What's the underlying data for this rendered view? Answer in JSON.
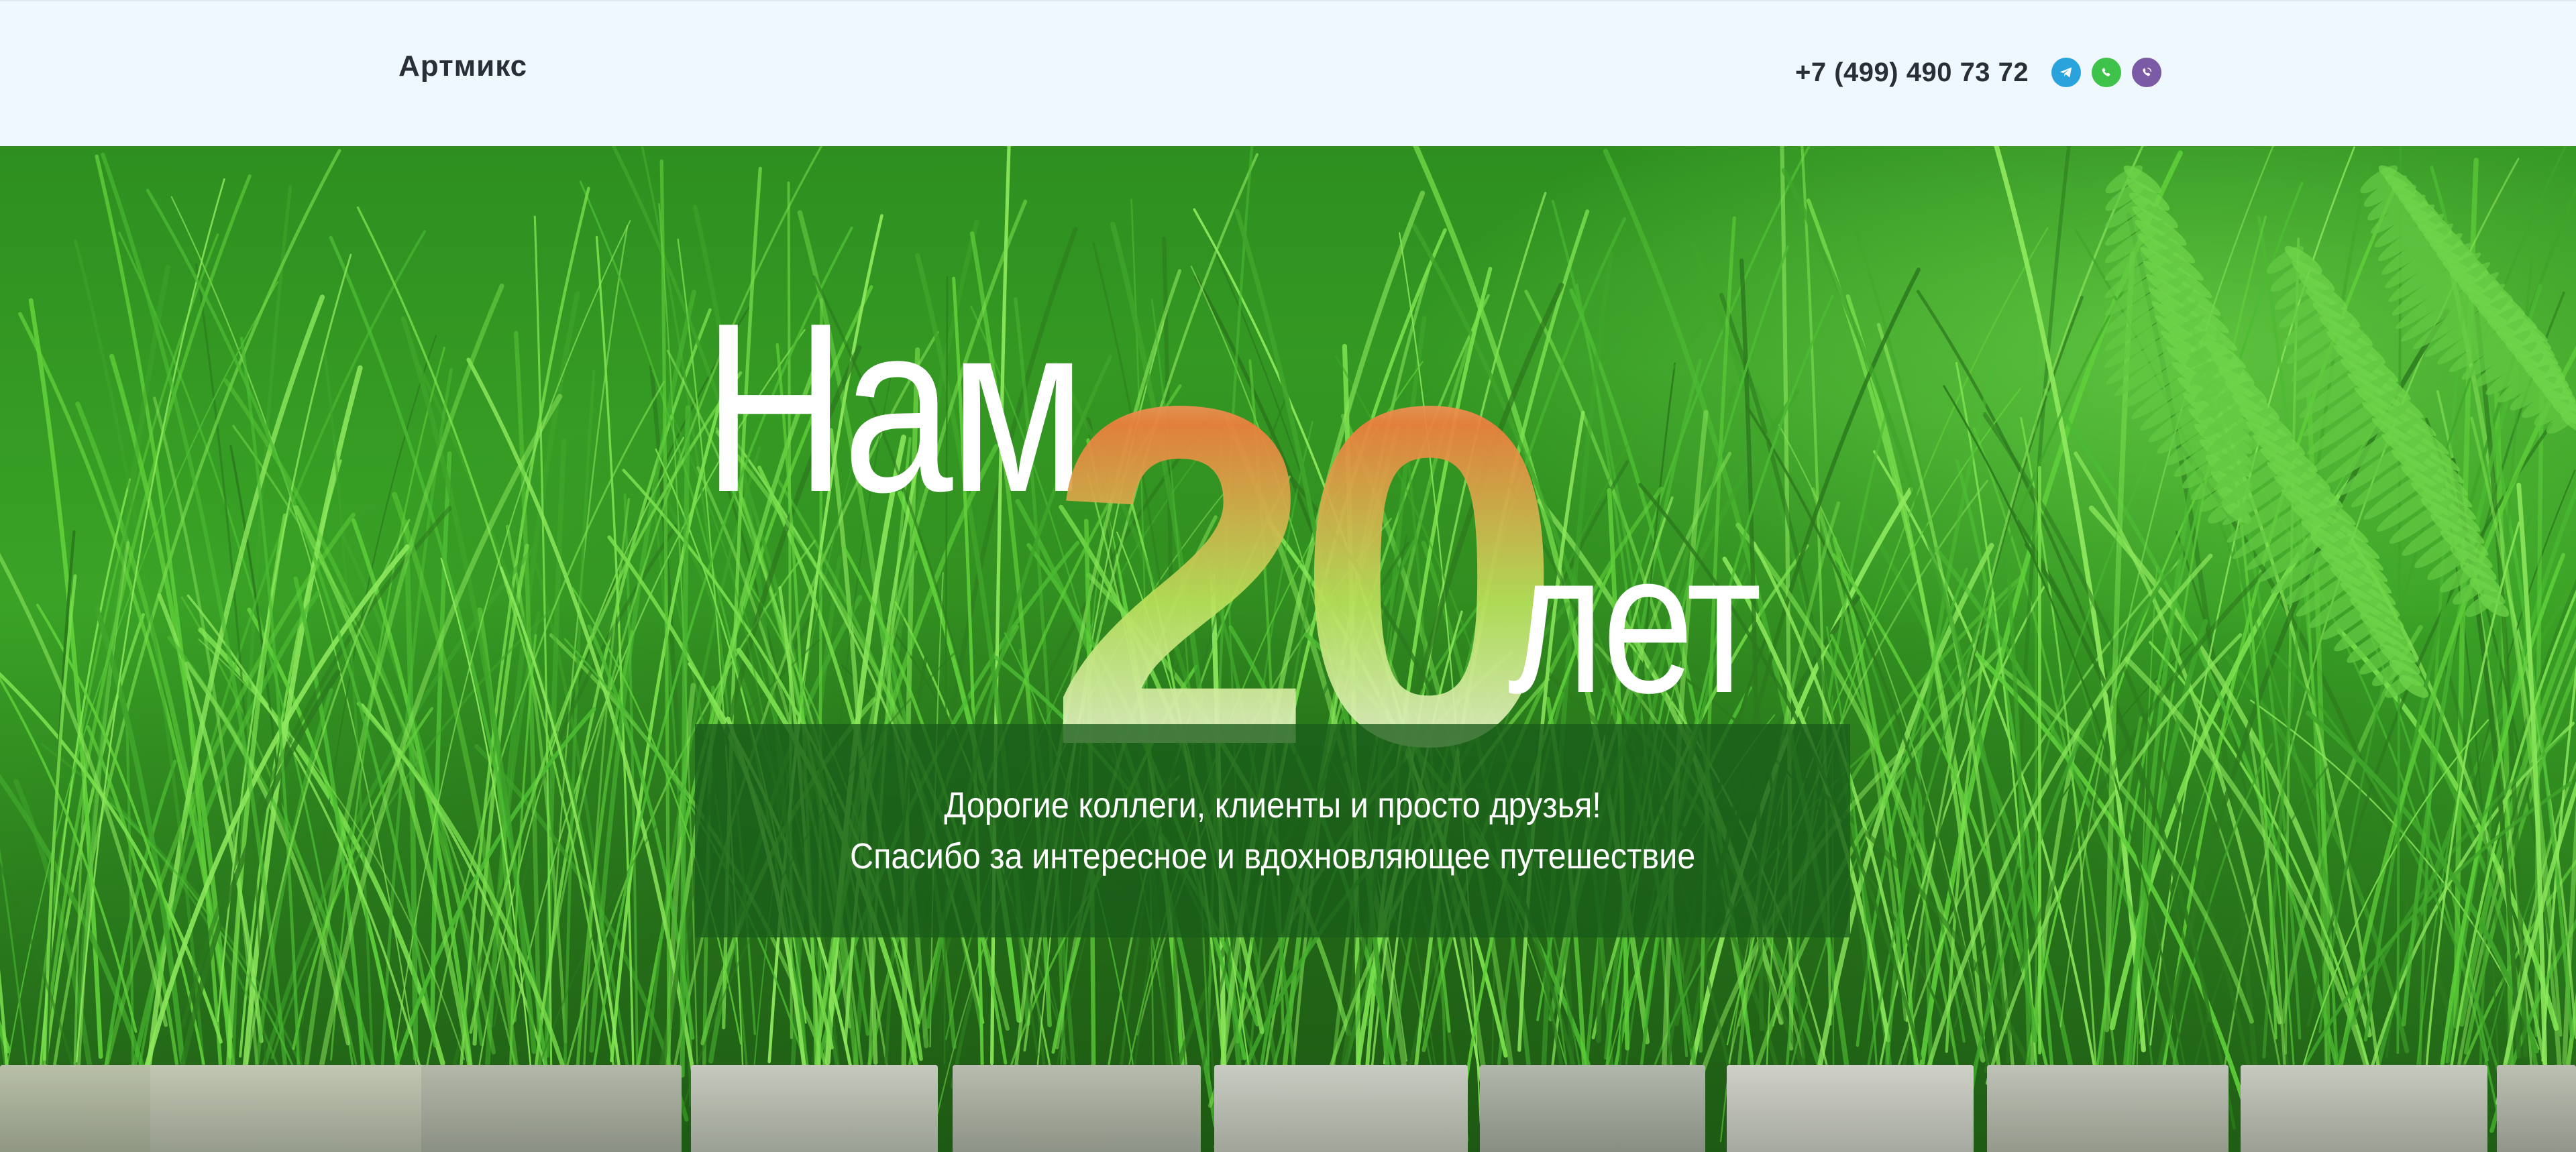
{
  "header": {
    "logo": "Артмикс",
    "phone": "+7 (499) 490 73 72",
    "messengers": [
      {
        "name": "telegram-icon",
        "color": "#2aa3dc"
      },
      {
        "name": "whatsapp-icon",
        "color": "#3fc24a"
      },
      {
        "name": "viber-icon",
        "color": "#7b5aa6"
      }
    ]
  },
  "hero": {
    "title_prefix": "Нам",
    "title_number": "20",
    "title_suffix": "лет",
    "message_lines": [
      "Дорогие коллеги, клиенты и просто друзья!",
      "Спасибо за интересное и вдохновляющее путешествие"
    ],
    "background": "grass-and-fern-photo",
    "colors": {
      "grass_dark": "#1f5e15",
      "grass_light": "#5fcf3a",
      "message_box": "#1a5c1a",
      "number_gradient": [
        "#f4f9c8",
        "#ef7e3e",
        "#8fd63c"
      ]
    }
  }
}
